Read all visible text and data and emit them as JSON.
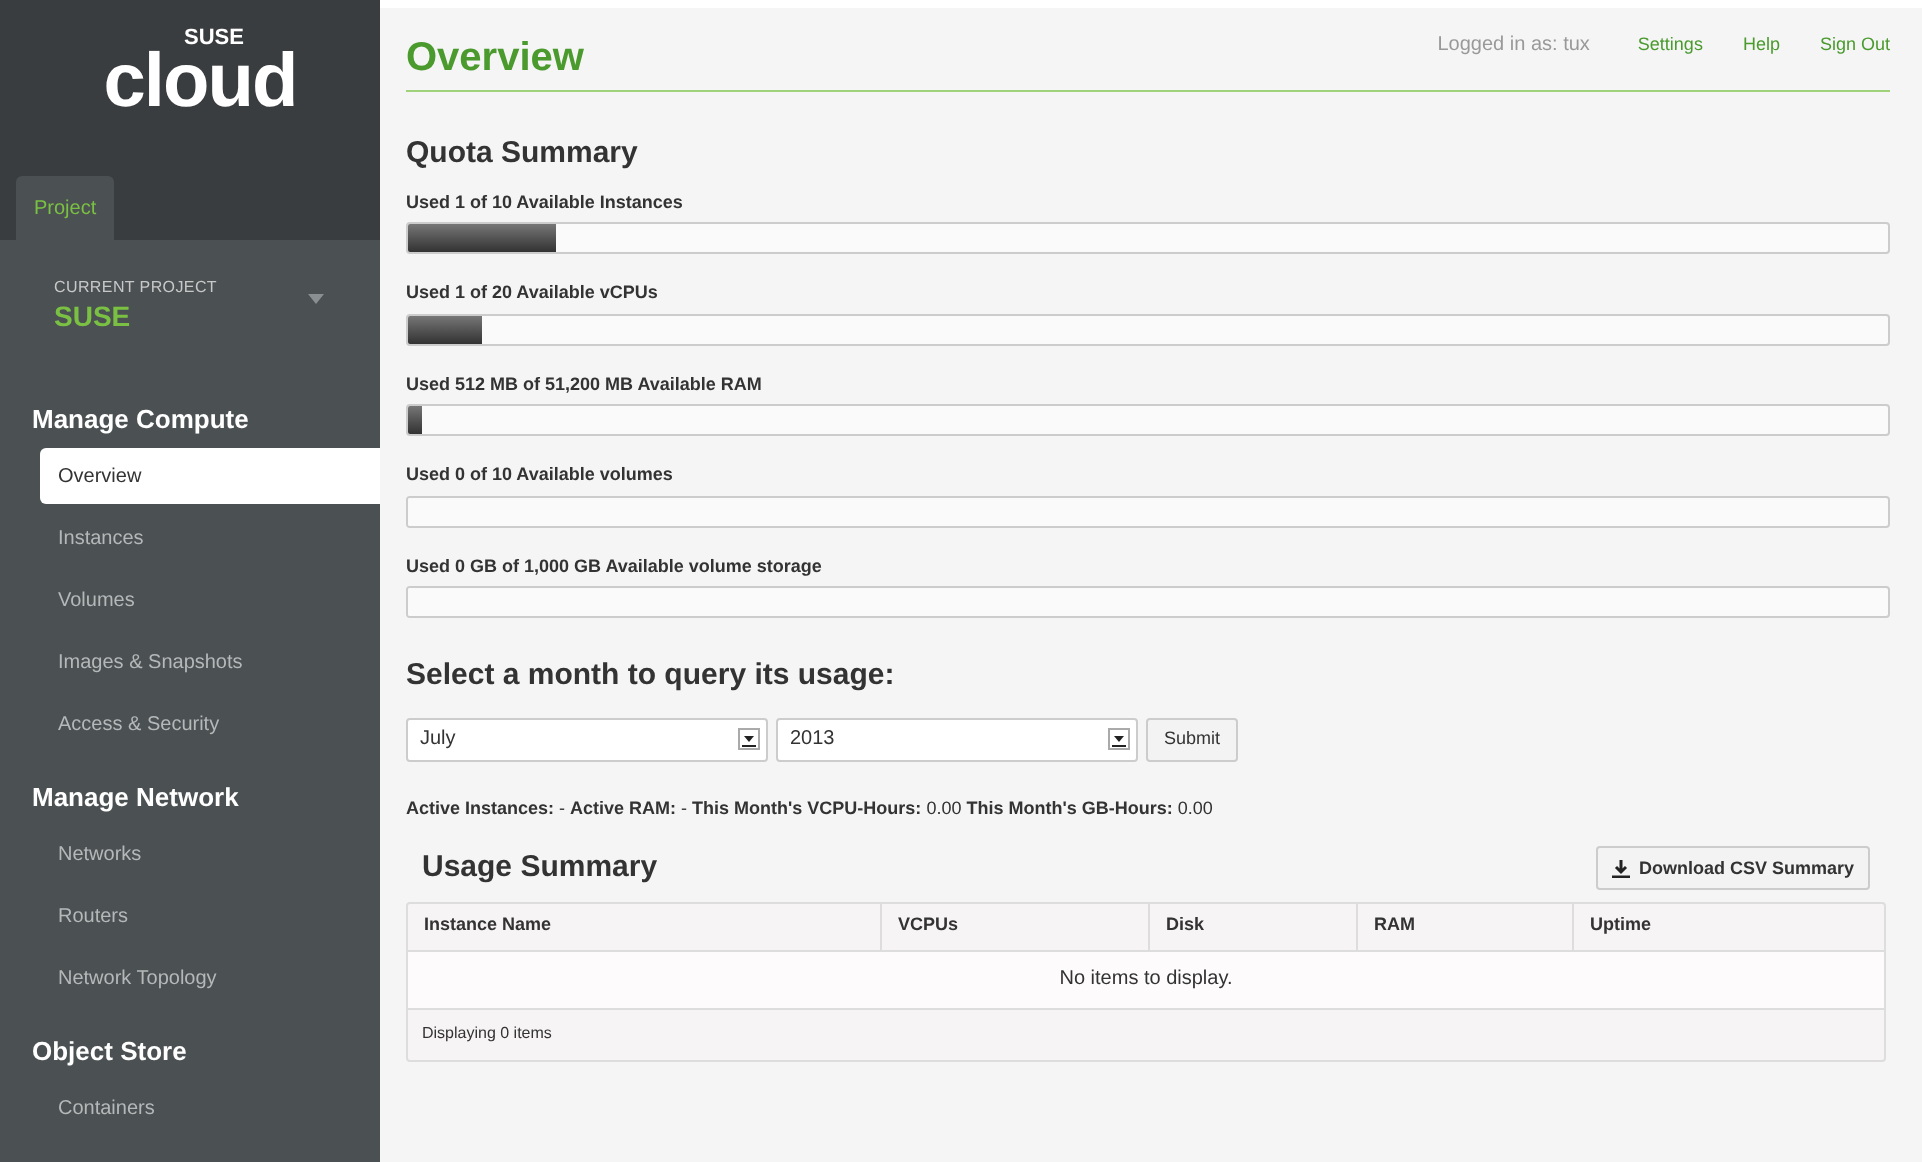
{
  "logo": {
    "small": "SUSE",
    "large": "cloud"
  },
  "sidebar": {
    "tabs": [
      {
        "label": "Project",
        "selected": true
      }
    ],
    "current_project": {
      "caption": "CURRENT PROJECT",
      "name": "SUSE"
    },
    "sections": [
      {
        "title": "Manage Compute",
        "items": [
          {
            "label": "Overview",
            "selected": true
          },
          {
            "label": "Instances",
            "selected": false
          },
          {
            "label": "Volumes",
            "selected": false
          },
          {
            "label": "Images & Snapshots",
            "selected": false
          },
          {
            "label": "Access & Security",
            "selected": false
          }
        ]
      },
      {
        "title": "Manage Network",
        "items": [
          {
            "label": "Networks",
            "selected": false
          },
          {
            "label": "Routers",
            "selected": false
          },
          {
            "label": "Network Topology",
            "selected": false
          }
        ]
      },
      {
        "title": "Object Store",
        "items": [
          {
            "label": "Containers",
            "selected": false
          }
        ]
      }
    ]
  },
  "header": {
    "title": "Overview",
    "user": "Logged in as: tux",
    "links": [
      "Settings",
      "Help",
      "Sign Out"
    ]
  },
  "quota": {
    "title": "Quota Summary",
    "items": [
      {
        "label": "Used 1 of 10 Available Instances",
        "level": 0.1
      },
      {
        "label": "Used 1 of 20 Available vCPUs",
        "level": 0.05
      },
      {
        "label": "Used 512 MB of 51,200 MB Available RAM",
        "level": 0.01
      },
      {
        "label": "Used 0 of 10 Available volumes",
        "level": 0
      },
      {
        "label": "Used 0 GB of 1,000 GB Available volume storage",
        "level": 0
      }
    ]
  },
  "usage_query": {
    "title": "Select a month to query its usage:",
    "month": "July",
    "year": "2013",
    "button": "Submit"
  },
  "stats": "**Active Instances:** - **Active RAM:** - **This Month's VCPU-Hours:** 0.00 **This Month's GB-Hours:** 0.00",
  "usage_summary": {
    "title": "Usage Summary",
    "download": "Download CSV Summary",
    "columns": [
      "Instance Name",
      "VCPUs",
      "Disk",
      "RAM",
      "Uptime"
    ],
    "empty": "No items to display.",
    "footer": "Displaying 0 items"
  }
}
